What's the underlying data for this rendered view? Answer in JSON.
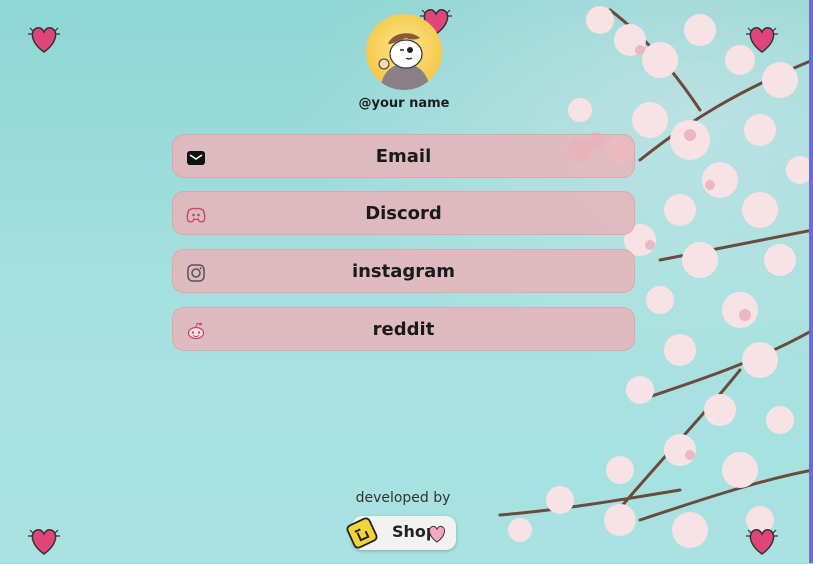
{
  "profile": {
    "username": "@your name",
    "avatar_icon": "cartoon-avatar"
  },
  "links": [
    {
      "label": "Email",
      "icon": "mail-icon"
    },
    {
      "label": "Discord",
      "icon": "discord-icon"
    },
    {
      "label": "instagram",
      "icon": "instagram-icon"
    },
    {
      "label": "reddit",
      "icon": "reddit-icon"
    }
  ],
  "footer": {
    "developed_by": "developed by",
    "shop_label": "Shop"
  },
  "colors": {
    "background": "#9fdcd9",
    "button": "#e8b4ba",
    "heart": "#e0457a",
    "shop_logo": "#f2d43a"
  }
}
